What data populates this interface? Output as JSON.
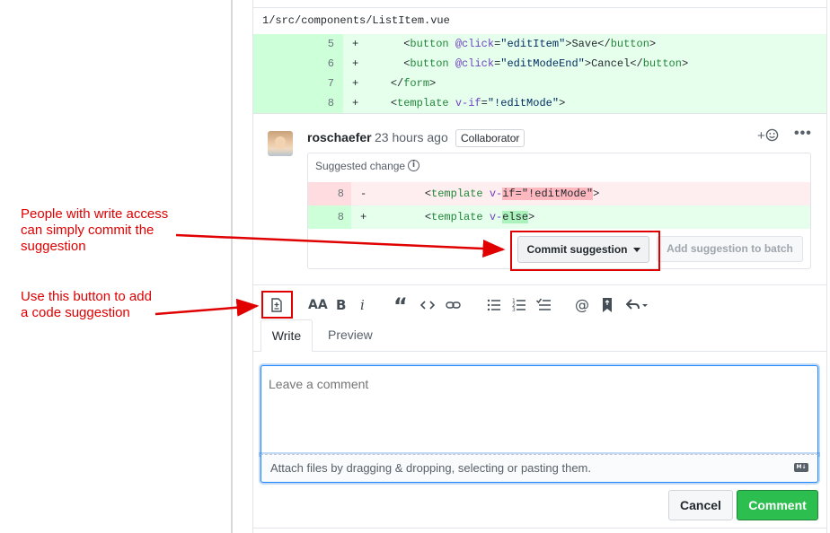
{
  "file": {
    "path": "1/src/components/ListItem.vue"
  },
  "diff_lines": [
    {
      "num": "5",
      "sign": "+",
      "indent": "      ",
      "open": "<",
      "tag": "button",
      "sp": " ",
      "attr": "@click",
      "eq": "=",
      "str": "\"editItem\"",
      "rest_open": ">",
      "text": "Save",
      "close": "</",
      "ctag": "button",
      "end": ">"
    },
    {
      "num": "6",
      "sign": "+",
      "indent": "      ",
      "open": "<",
      "tag": "button",
      "sp": " ",
      "attr": "@click",
      "eq": "=",
      "str": "\"editModeEnd\"",
      "rest_open": ">",
      "text": "Cancel",
      "close": "</",
      "ctag": "button",
      "end": ">"
    },
    {
      "num": "7",
      "sign": "+",
      "indent": "    ",
      "open": "</",
      "tag": "form",
      "sp": "",
      "attr": "",
      "eq": "",
      "str": "",
      "rest_open": ">",
      "text": "",
      "close": "",
      "ctag": "",
      "end": ""
    },
    {
      "num": "8",
      "sign": "+",
      "indent": "    ",
      "open": "<",
      "tag": "template",
      "sp": " ",
      "attr": "v-if",
      "eq": "=",
      "str": "\"!editMode\"",
      "rest_open": ">",
      "text": "",
      "close": "",
      "ctag": "",
      "end": ""
    }
  ],
  "comment": {
    "author": "roschaefer",
    "time": "23 hours ago",
    "badge": "Collaborator",
    "react_label": "+",
    "more_label": "•••"
  },
  "suggestion": {
    "title": "Suggested change",
    "info_icon": "i",
    "del": {
      "num": "8",
      "sign": "-",
      "indent": "    ",
      "tag": "template",
      "attr_prefix": "v-",
      "highlight": "if=\"!editMode\"",
      "end": ">"
    },
    "add": {
      "num": "8",
      "sign": "+",
      "indent": "    ",
      "tag": "template",
      "attr_prefix": "v-",
      "highlight": "else",
      "end": ">"
    },
    "commit_label": "Commit suggestion",
    "batch_label": "Add suggestion to batch"
  },
  "annotations": {
    "commit_note": [
      "People with write access",
      "can simply commit the",
      "suggestion"
    ],
    "suggest_note": [
      "Use this button to add",
      "a code suggestion"
    ],
    "color": "#e00000"
  },
  "toolbar": {
    "heading": "AA",
    "bold": "B",
    "italic": "i",
    "quote": "“",
    "mention": "@"
  },
  "tabs": {
    "write": "Write",
    "preview": "Preview"
  },
  "editor": {
    "placeholder": "Leave a comment",
    "attach_text": "Attach files by dragging & dropping, selecting or pasting them.",
    "md_label": "M↓"
  },
  "actions": {
    "cancel": "Cancel",
    "comment": "Comment"
  },
  "colors": {
    "add_bg": "#e6ffed",
    "del_bg": "#ffeef0",
    "primary": "#2cbe4e",
    "focus": "#2188ff"
  }
}
